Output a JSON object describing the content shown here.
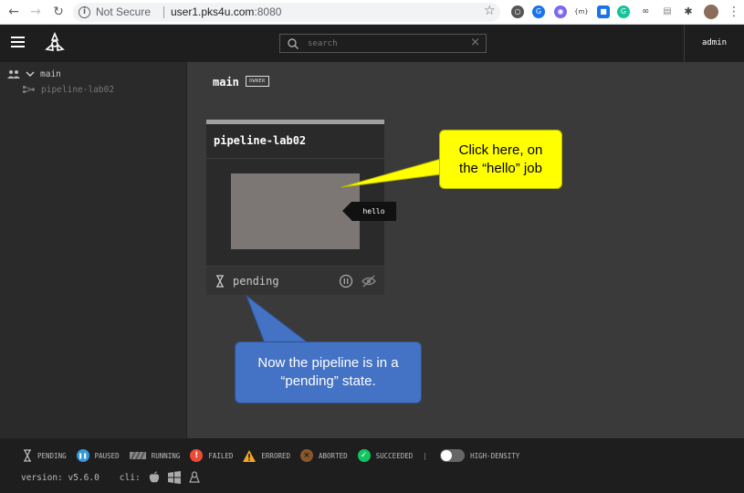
{
  "browser": {
    "security_label": "Not Secure",
    "url_host": "user1.pks4u.com",
    "url_port": ":8080",
    "ext_badge_text": "{m}"
  },
  "header": {
    "search_placeholder": "search",
    "user": "admin"
  },
  "sidebar": {
    "team": "main",
    "pipeline": "pipeline-lab02"
  },
  "main": {
    "team_name": "main",
    "owner_badge": "OWNER",
    "pipeline_card": {
      "name": "pipeline-lab02",
      "status": "pending",
      "job_tooltip": "hello"
    }
  },
  "callouts": {
    "yellow": [
      "Click here, on",
      "the “hello” job"
    ],
    "blue": [
      "Now the pipeline is in a",
      "“pending” state."
    ]
  },
  "legend": {
    "items": [
      {
        "label": "PENDING",
        "icon": "hourglass-icon"
      },
      {
        "label": "PAUSED",
        "icon": "pause-icon",
        "color": "#3498db"
      },
      {
        "label": "RUNNING",
        "icon": "running-stripes-icon"
      },
      {
        "label": "FAILED",
        "icon": "exclamation-icon",
        "color": "#ed4b35"
      },
      {
        "label": "ERRORED",
        "icon": "warning-triangle-icon",
        "color": "#f5a623"
      },
      {
        "label": "ABORTED",
        "icon": "x-circle-icon",
        "color": "#8b572a"
      },
      {
        "label": "SUCCEEDED",
        "icon": "check-circle-icon",
        "color": "#11c560"
      }
    ],
    "divider": "|",
    "high_density_label": "HIGH-DENSITY",
    "version": "version: v5.6.0",
    "cli_label": "cli:"
  }
}
